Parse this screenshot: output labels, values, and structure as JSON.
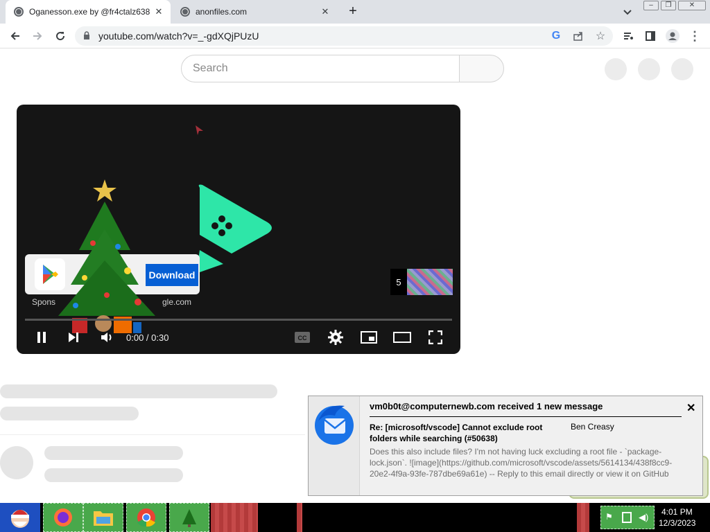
{
  "browser": {
    "tabs": [
      {
        "title": "Oganesson.exe by @fr4ctalz638",
        "active": true
      },
      {
        "title": "anonfiles.com",
        "active": false
      }
    ],
    "new_tab_label": "+",
    "url": "youtube.com/watch?v=_-gdXQjPUzU"
  },
  "youtube": {
    "search_placeholder": "Search",
    "player": {
      "timecode": "0:00 / 0:30",
      "ad": {
        "button_label": "Download",
        "sponsored_label": "Spons",
        "domain_label": "gle.com",
        "skip_countdown": "5"
      }
    }
  },
  "notification": {
    "title": "vm0b0t@computernewb.com received 1 new message",
    "subject": "Re: [microsoft/vscode] Cannot exclude root folders while searching (#50638)",
    "sender": "Ben Creasy",
    "body": "Does this also include files? I'm not having luck excluding a root file - `package-lock.json`. ![image](https://github.com/microsoft/vscode/assets/5614134/438f8cc9-20e2-4f9a-93fe-787dbe69a61e) -- Reply to this email directly or view it on GitHub",
    "close_label": "✕"
  },
  "taskbar": {
    "time": "4:01 PM",
    "date": "12/3/2023"
  },
  "colors": {
    "accent": "#065fd4",
    "play_logo": "#2ee6a8",
    "taskbar_app": "#49a84b"
  }
}
